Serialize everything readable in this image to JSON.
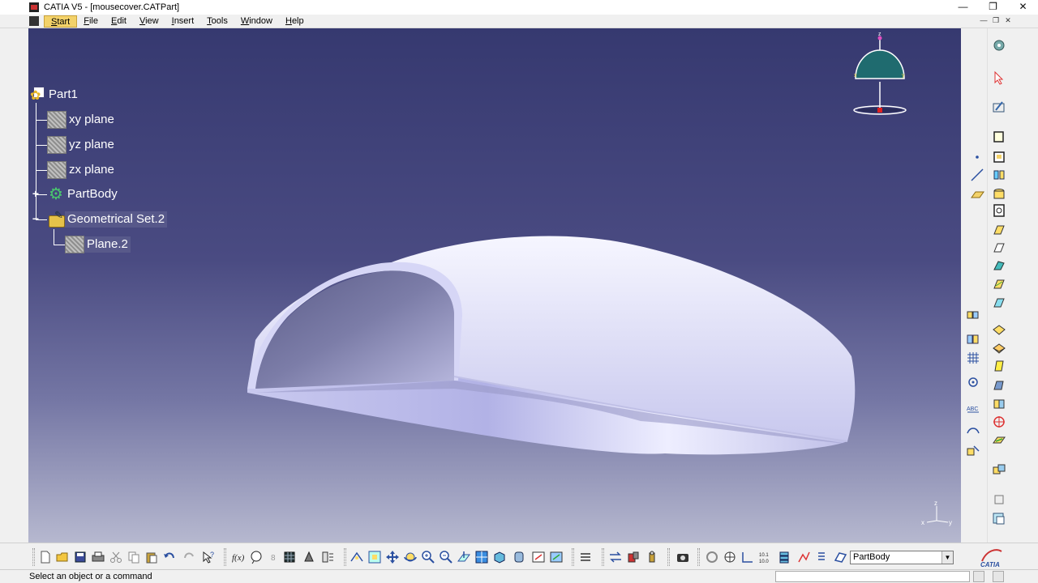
{
  "window": {
    "title": "CATIA V5 - [mousecover.CATPart]",
    "minimize": "—",
    "maximize": "❐",
    "close": "✕"
  },
  "menu": {
    "items": [
      "Start",
      "File",
      "Edit",
      "View",
      "Insert",
      "Tools",
      "Window",
      "Help"
    ],
    "active": "Start",
    "mdi": {
      "minimize": "—",
      "restore": "❐",
      "close": "✕"
    }
  },
  "tree": {
    "root": "Part1",
    "planes": [
      "xy plane",
      "yz plane",
      "zx plane"
    ],
    "body": "PartBody",
    "geo_set": "Geometrical Set.2",
    "geo_child": "Plane.2",
    "expand_plus": "+",
    "expand_minus": "−"
  },
  "compass": {
    "label_z": "z",
    "label_x": "x",
    "label_y": "y"
  },
  "triad": {
    "label_z": "z",
    "label_x": "x",
    "label_y": "y"
  },
  "toolbar": {
    "current_body": "PartBody",
    "dropdown_arrow": "▼",
    "catia_logo_text": "CATIA"
  },
  "status": {
    "message": "Select an object or a command"
  },
  "colors": {
    "bg_top": "#363970",
    "bg_bottom": "#b6b8cf",
    "model": "#dcdcf5",
    "accent": "#f3d26a"
  }
}
